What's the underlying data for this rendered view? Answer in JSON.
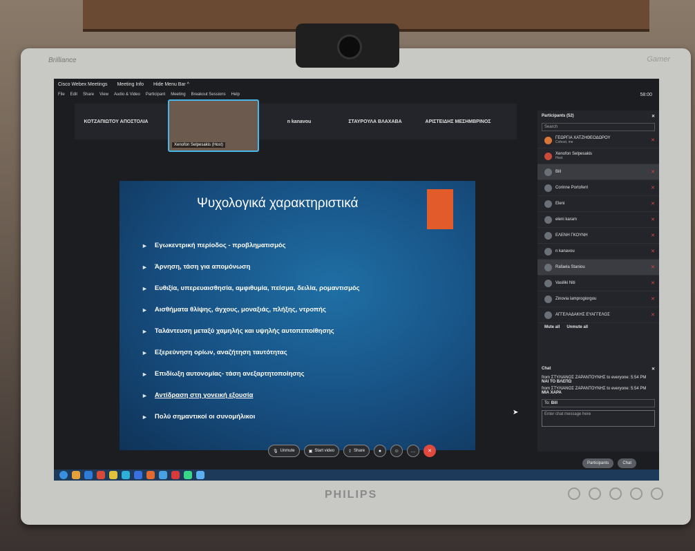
{
  "titlebar": {
    "app_name": "Cisco Webex Meetings",
    "meeting_info": "Meeting Info",
    "hide_menu": "Hide Menu Bar ^"
  },
  "menu": [
    "File",
    "Edit",
    "Share",
    "View",
    "Audio & Video",
    "Participant",
    "Meeting",
    "Breakout Sessions",
    "Help"
  ],
  "clock": "58:00",
  "strip": {
    "tiles": [
      "ΚΟΤΖΑΠΙΩΤΟΥ ΑΠΟΣΤΟΛΙΑ",
      "n kanavou",
      "ΣΤΑΥΡΟΥΛΑ ΒΛΑΧΑΒΑ",
      "ΑΡΙΣΤΕΙΔΗΣ ΜΕΣΗΜΒΡΙΝΟΣ"
    ],
    "video_label": "Xenofon Selpesakis (Host)"
  },
  "slide": {
    "title": "Ψυχολογικά χαρακτηριστικά",
    "bullets": [
      "Εγωκεντρική περίοδος - προβληματισμός",
      "Άρνηση, τάση για απομόνωση",
      "Ευθιξία, υπερευαισθησία, αμφιθυμία, πείσμα, δειλία, ρομαντισμός",
      "Αισθήματα θλίψης, άγχους, μοναξιάς, πλήξης, ντροπής",
      "Ταλάντευση μεταξύ χαμηλής και υψηλής αυτοπεποίθησης",
      "Εξερεύνηση ορίων, αναζήτηση ταυτότητας",
      "Επιδίωξη αυτονομίας- τάση ανεξαρτητοποίησης",
      "Αντίδραση στη γονεική εξουσία",
      "Πολύ σημαντικοί οι συνομήλικοι"
    ]
  },
  "controls": {
    "unmute": "Unmute",
    "start_video": "Start video",
    "share": "Share"
  },
  "participants": {
    "title": "Participants (52)",
    "search_placeholder": "Search",
    "list": [
      {
        "name": "ΓΕΩΡΓΙΑ ΧΑΤΖΗΘΕΟΔΩΡΟΥ",
        "sub": "Cohost, me"
      },
      {
        "name": "Xenofon Selpesakis",
        "sub": "Host"
      },
      {
        "name": "Bill",
        "sub": ""
      },
      {
        "name": "Corinne Portoferri",
        "sub": ""
      },
      {
        "name": "Eleni",
        "sub": ""
      },
      {
        "name": "eleni karam",
        "sub": ""
      },
      {
        "name": "ΕΛΕΝΗ ΓΚΟΥΝΗ",
        "sub": ""
      },
      {
        "name": "n kanavou",
        "sub": ""
      },
      {
        "name": "Rafaela Staniou",
        "sub": ""
      },
      {
        "name": "Vasiliki Niti",
        "sub": ""
      },
      {
        "name": "Zinovia lamprogiorgou",
        "sub": ""
      },
      {
        "name": "ΑΓΓΕΛΑΔΑΚΗΣ ΕΥΑΓΓΕΛΟΣ",
        "sub": ""
      }
    ],
    "mute_all": "Mute all",
    "unmute_all": "Unmute all"
  },
  "chat": {
    "title": "Chat",
    "messages": [
      {
        "from": "from ΣΤΥΛΙΑΝΟΣ ΖΑΡΑΝΤΟΥΝΗΣ to everyone: 5:54 PM",
        "text": "ΝΑΙ ΤΟ ΒΛΕΠΩ"
      },
      {
        "from": "from ΣΤΥΛΙΑΝΟΣ ΖΑΡΑΝΤΟΥΝΗΣ to everyone: 5:54 PM",
        "text": "ΜΙΑ ΧΑΡΑ"
      }
    ],
    "to_label": "To:",
    "to_value": "Bill",
    "input_placeholder": "Enter chat message here"
  },
  "bottom_buttons": {
    "participants": "Participants",
    "chat": "Chat"
  },
  "monitor": {
    "brand": "Brilliance",
    "maker": "PHILIPS",
    "overlay": "Gamer"
  }
}
